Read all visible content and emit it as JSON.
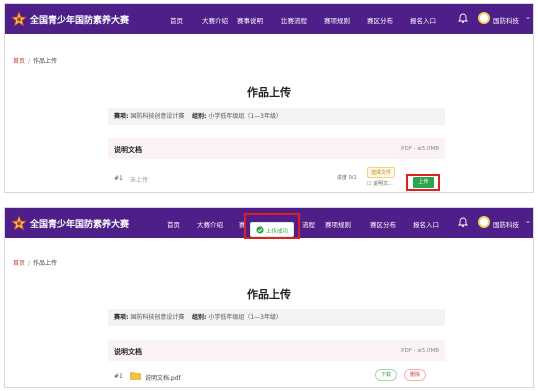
{
  "brand": "全国青少年国防素养大赛",
  "nav_items": [
    "首页",
    "大赛介绍",
    "赛事说明",
    "比赛流程",
    "赛项规则",
    "赛区分布",
    "报名入口"
  ],
  "nav_items_partial": [
    "首页",
    "大赛介绍",
    "赛",
    "流程",
    "赛项规则",
    "赛区分布",
    "报名入口"
  ],
  "user_name": "国防科技",
  "breadcrumb": {
    "home": "首页",
    "current": "作品上传"
  },
  "page_title": "作品上传",
  "info": {
    "track_label": "赛项:",
    "track_value": "国防科技创意设计赛",
    "group_label": "组别:",
    "group_value": "小学低年级组（1—3年级）"
  },
  "docs": {
    "title": "说明文档",
    "limit": "PDF · ≤5.0MB"
  },
  "before": {
    "num": "#1",
    "status": "未上传",
    "progress": "进度 0/1",
    "choose": "选择文件",
    "file_btn": "☐ 说明文...",
    "upload": "上传"
  },
  "after": {
    "num": "#1",
    "file": "说明文档.pdf",
    "download": "下载",
    "delete": "删除"
  },
  "toast": "上传成功",
  "colors": {
    "nav": "#4e1f89",
    "success": "#2fa34a",
    "highlight": "#e02020",
    "danger": "#d43c3c"
  }
}
